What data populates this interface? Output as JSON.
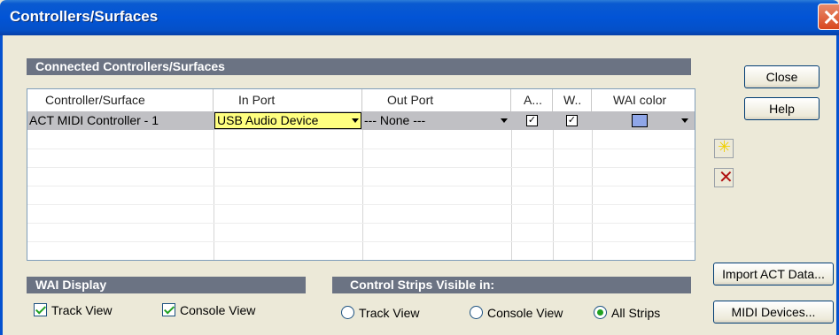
{
  "window": {
    "title": "Controllers/Surfaces"
  },
  "connected": {
    "header": "Connected Controllers/Surfaces",
    "columns": [
      "Controller/Surface",
      "In Port",
      "Out Port",
      "A...",
      "W..",
      "WAI color"
    ],
    "rows": [
      {
        "controller": "ACT MIDI Controller - 1",
        "in_port": "USB Audio Device",
        "out_port": "--- None ---",
        "a_checked": "✓",
        "w_checked": "✓",
        "wai_color": "#8fa6e8"
      }
    ]
  },
  "buttons": {
    "close": "Close",
    "help": "Help",
    "import_act": "Import ACT Data...",
    "midi_devices": "MIDI Devices..."
  },
  "wai_display": {
    "header": "WAI Display",
    "track_view": "Track View",
    "console_view": "Console View"
  },
  "control_strips": {
    "header": "Control Strips Visible in:",
    "track_view": "Track View",
    "console_view": "Console View",
    "all_strips": "All Strips",
    "selected": "All Strips"
  },
  "icons": {
    "add": "add-star-icon",
    "delete": "delete-x-icon"
  }
}
